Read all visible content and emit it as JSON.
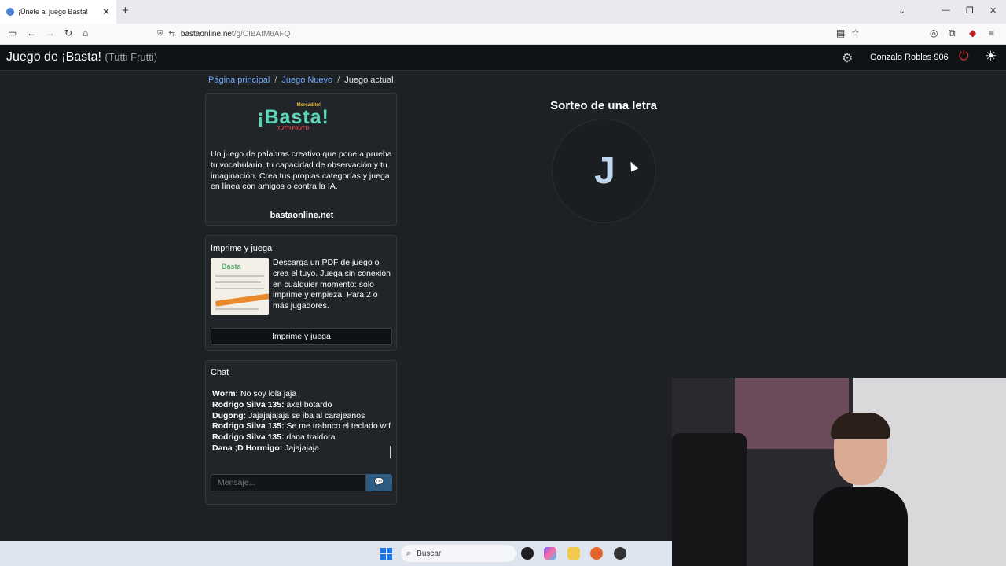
{
  "browser": {
    "tab_title": "¡Únete al juego Basta!",
    "tab_close": "✕",
    "new_tab": "+",
    "url_host": "bastaonline.net",
    "url_path": "/g/CIBAIM6AFQ",
    "window_minimize": "—",
    "window_restore": "❐",
    "window_close": "✕"
  },
  "header": {
    "brand": "Juego de ¡Basta!",
    "brand_sub": "(Tutti Frutti)",
    "user": "Gonzalo Robles 906"
  },
  "breadcrumb": {
    "home": "Página principal",
    "new_game": "Juego Nuevo",
    "current": "Juego actual",
    "separator": "/"
  },
  "intro": {
    "logo_top": "Mercadito!",
    "logo_main": "¡Basta!",
    "logo_bottom": "TUTTI FRUTTI",
    "text": "Un juego de palabras creativo que pone a prueba tu vocabulario, tu capacidad de observación y tu imaginación. Crea tus propias categorías y juega en línea con amigos o contra la IA.",
    "site": "bastaonline.net"
  },
  "print": {
    "title": "Imprime y juega",
    "text": "Descarga un PDF de juego o crea el tuyo. Juega sin conexión en cualquier momento: solo imprime y empieza. Para 2 o más jugadores.",
    "button": "Imprime y juega",
    "thumb_label": "Basta"
  },
  "chat": {
    "title": "Chat",
    "messages": [
      {
        "who": "Worm:",
        "text": "No soy lola jaja"
      },
      {
        "who": "Rodrigo Silva 135:",
        "text": "axel botardo"
      },
      {
        "who": "Dugong:",
        "text": "Jajajajajaja se iba al carajeanos"
      },
      {
        "who": "Rodrigo Silva 135:",
        "text": "Se me trabnco el teclado wtf"
      },
      {
        "who": "Rodrigo Silva 135:",
        "text": "dana traidora"
      },
      {
        "who": "Dana ;D Hormigo:",
        "text": "Jajajajaja"
      }
    ],
    "input_placeholder": "Mensaje..."
  },
  "draw": {
    "title": "Sorteo de una letra",
    "letter": "J"
  },
  "taskbar": {
    "search_label": "Buscar"
  },
  "colors": {
    "page_bg": "#1e2124",
    "card_bg": "#212529",
    "link": "#6ea8fe",
    "power": "#e03131",
    "letter": "#bfd6ee",
    "logo": "#5fd6b6"
  }
}
